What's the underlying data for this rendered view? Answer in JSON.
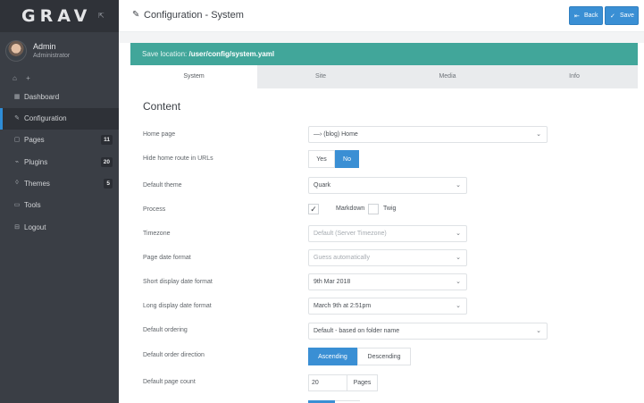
{
  "brand": {
    "logo": "GRAV",
    "toggle_icon": "expand-icon"
  },
  "user": {
    "name": "Admin",
    "role": "Administrator"
  },
  "quick_actions": [
    "home-icon",
    "plus-icon"
  ],
  "sidebar": {
    "items": [
      {
        "label": "Dashboard",
        "icon": "dashboard-icon",
        "badge": null,
        "active": false
      },
      {
        "label": "Configuration",
        "icon": "wrench-icon",
        "badge": null,
        "active": true
      },
      {
        "label": "Pages",
        "icon": "file-icon",
        "badge": "11",
        "active": false
      },
      {
        "label": "Plugins",
        "icon": "plug-icon",
        "badge": "20",
        "active": false
      },
      {
        "label": "Themes",
        "icon": "tint-icon",
        "badge": "5",
        "active": false
      },
      {
        "label": "Tools",
        "icon": "briefcase-icon",
        "badge": null,
        "active": false
      },
      {
        "label": "Logout",
        "icon": "sign-out-icon",
        "badge": null,
        "active": false
      }
    ]
  },
  "header": {
    "title": "Configuration - System",
    "back_label": "Back",
    "save_label": "Save"
  },
  "banner": {
    "prefix": "Save location:",
    "path": "/user/config/system.yaml"
  },
  "tabs": [
    {
      "label": "System",
      "active": true
    },
    {
      "label": "Site",
      "active": false
    },
    {
      "label": "Media",
      "active": false
    },
    {
      "label": "Info",
      "active": false
    }
  ],
  "content": {
    "section_title": "Content",
    "home_page": {
      "label": "Home page",
      "value": "—› (blog) Home"
    },
    "hide_home": {
      "label": "Hide home route in URLs",
      "yes": "Yes",
      "no": "No",
      "selected": "No"
    },
    "default_theme": {
      "label": "Default theme",
      "value": "Quark"
    },
    "process": {
      "label": "Process",
      "markdown": "Markdown",
      "twig": "Twig",
      "markdown_checked": true,
      "twig_checked": false
    },
    "timezone": {
      "label": "Timezone",
      "placeholder": "Default (Server Timezone)"
    },
    "page_date_format": {
      "label": "Page date format",
      "placeholder": "Guess automatically"
    },
    "short_date_format": {
      "label": "Short display date format",
      "value": "9th Mar 2018"
    },
    "long_date_format": {
      "label": "Long display date format",
      "value": "March 9th at 2:51pm"
    },
    "default_ordering": {
      "label": "Default ordering",
      "value": "Default - based on folder name"
    },
    "order_direction": {
      "label": "Default order direction",
      "ascending": "Ascending",
      "descending": "Descending",
      "selected": "Ascending"
    },
    "page_count": {
      "label": "Default page count",
      "value": "20",
      "unit": "Pages"
    }
  },
  "colors": {
    "accent": "#3a8fd4",
    "banner": "#41a69a",
    "sidebar": "#3a3e45"
  }
}
